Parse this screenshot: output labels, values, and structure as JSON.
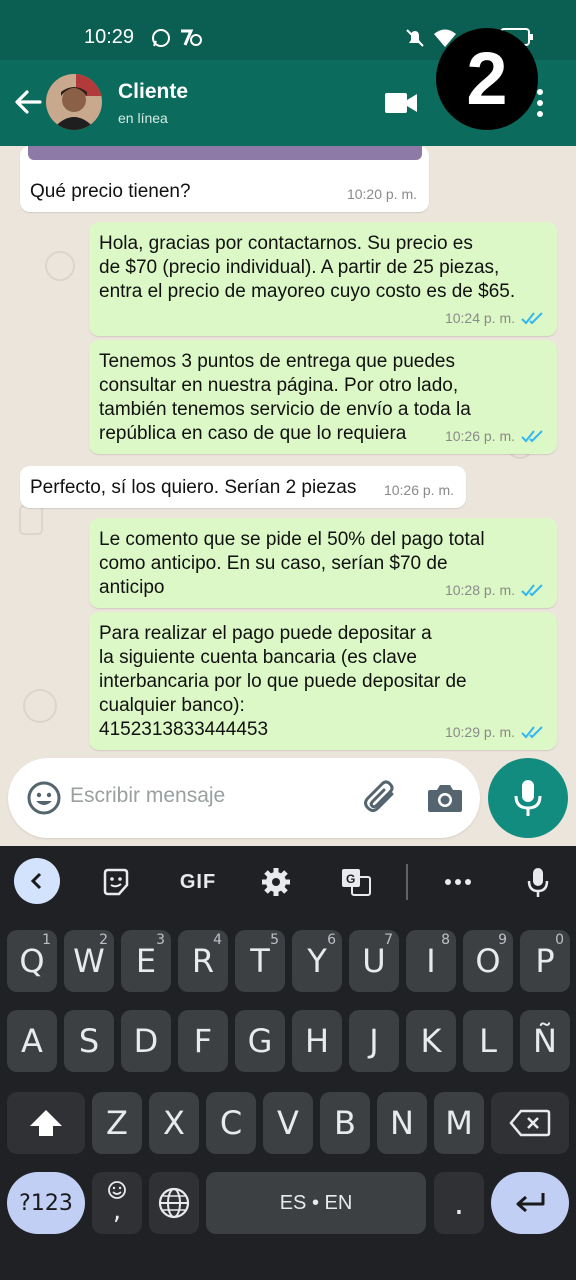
{
  "status_bar": {
    "time": "10:29"
  },
  "header": {
    "contact_name": "Cliente",
    "contact_status": "en línea",
    "overlay_badge": "2"
  },
  "messages": [
    {
      "direction": "in",
      "text": "Qué precio tienen?",
      "time": "10:20 p. m."
    },
    {
      "direction": "out",
      "text": "Hola, gracias por contactarnos. Su precio es\nde $70 (precio individual). A partir de 25 piezas,\nentra el precio de mayoreo cuyo costo es de $65.",
      "time": "10:24 p. m."
    },
    {
      "direction": "out",
      "text": "Tenemos 3 puntos de entrega que puedes\nconsultar en nuestra página. Por otro lado,\ntambién tenemos servicio de envío a toda la\nrepública en caso de que lo requiera",
      "time": "10:26 p. m."
    },
    {
      "direction": "in",
      "text": "Perfecto, sí los quiero. Serían 2 piezas",
      "time": "10:26 p. m."
    },
    {
      "direction": "out",
      "text": "Le comento que se pide el 50% del pago total\ncomo anticipo. En su caso, serían $70 de\nanticipo",
      "time": "10:28 p. m."
    },
    {
      "direction": "out",
      "text": "Para realizar el pago puede depositar a\nla siguiente cuenta bancaria (es clave\ninterbancaria por lo que puede depositar de\ncualquier banco):\n4152313833444453",
      "time": "10:29 p. m."
    }
  ],
  "composer": {
    "placeholder": "Escribir mensaje"
  },
  "keyboard": {
    "toolbar": {
      "gif_label": "GIF"
    },
    "row1": [
      {
        "k": "Q",
        "h": "1"
      },
      {
        "k": "W",
        "h": "2"
      },
      {
        "k": "E",
        "h": "3"
      },
      {
        "k": "R",
        "h": "4"
      },
      {
        "k": "T",
        "h": "5"
      },
      {
        "k": "Y",
        "h": "6"
      },
      {
        "k": "U",
        "h": "7"
      },
      {
        "k": "I",
        "h": "8"
      },
      {
        "k": "O",
        "h": "9"
      },
      {
        "k": "P",
        "h": "0"
      }
    ],
    "row2": [
      "A",
      "S",
      "D",
      "F",
      "G",
      "H",
      "J",
      "K",
      "L",
      "Ñ"
    ],
    "row3": [
      "Z",
      "X",
      "C",
      "V",
      "B",
      "N",
      "M"
    ],
    "symbols_label": "?123",
    "comma_label": ",",
    "space_label": "ES • EN",
    "period_label": "."
  },
  "colors": {
    "header": "#0b6b5c",
    "status_bar": "#0b5f52",
    "outgoing_bubble": "#dcf8c6",
    "incoming_bubble": "#ffffff",
    "read_ticks": "#34b7f1",
    "mic_button": "#128c7e"
  },
  "icons": {
    "status_bar": [
      "whatsapp-icon",
      "alarm-icon",
      "mute-icon",
      "wifi-icon",
      "battery-icon"
    ],
    "header": [
      "back-arrow-icon",
      "video-call-icon",
      "more-vert-icon"
    ],
    "composer": [
      "emoji-icon",
      "attach-icon",
      "camera-icon",
      "mic-icon"
    ],
    "keyboard_toolbar": [
      "chevron-left-icon",
      "sticker-icon",
      "settings-icon",
      "translate-icon",
      "more-horiz-icon",
      "mic-icon"
    ]
  }
}
